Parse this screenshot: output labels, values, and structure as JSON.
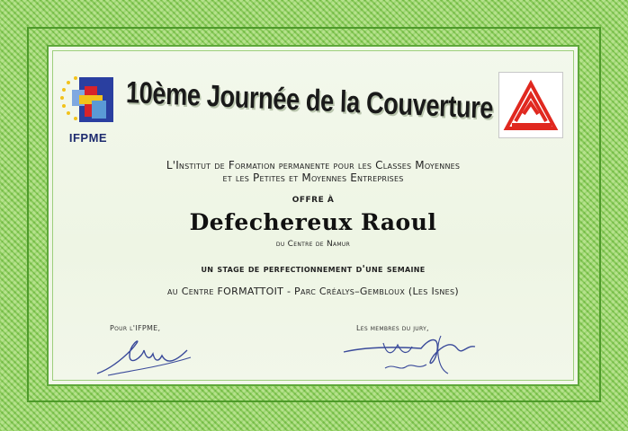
{
  "logos": {
    "left": {
      "name": "IFPME",
      "icon": "ifpme-logo-icon"
    },
    "right": {
      "icon": "triangle-logo-icon",
      "color": "#e0281f"
    }
  },
  "certificate": {
    "title": "10ème Journée de la Couverture",
    "institution_line1": "L'Institut de Formation permanente pour les Classes Moyennes",
    "institution_line2": "et les Petites et Moyennes Entreprises",
    "offer": "OFFRE À",
    "recipient": "Defechereux Raoul",
    "centre": "du Centre de Namur",
    "stage": "un stage de perfectionnement d'une semaine",
    "location": "au Centre FORMATTOIT - Parc Créalys–Gembloux (Les Isnes)"
  },
  "signatures": {
    "left_label": "Pour l'IFPME,",
    "right_label": "Les membres du jury,"
  },
  "colors": {
    "border_green": "#8ccf5e",
    "panel": "#f3f8ec",
    "ink": "#1a1a1a",
    "signature_ink": "#3a4a9a"
  }
}
